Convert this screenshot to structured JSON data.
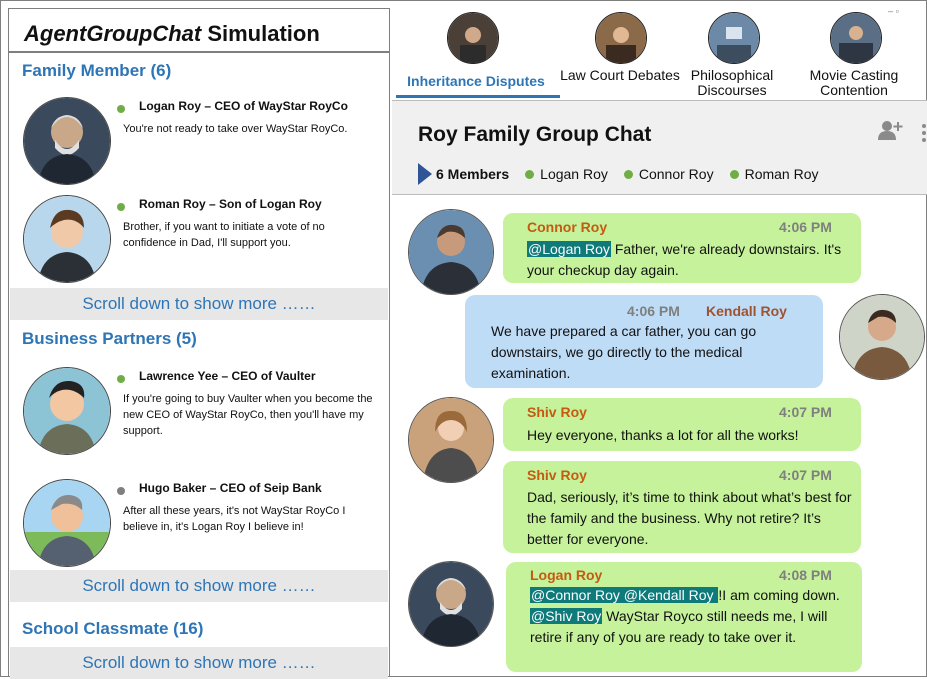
{
  "app": {
    "title_italic": "AgentGroupChat",
    "title_rest": " Simulation"
  },
  "sections": [
    {
      "header": "Family Member (6)",
      "more": "Scroll down to show more ……",
      "contacts": [
        {
          "name": "Logan Roy – CEO of WayStar RoyCo",
          "message": "You're not ready to take over WayStar RoyCo.",
          "status": "online"
        },
        {
          "name": "Roman Roy – Son of Logan Roy",
          "message": "Brother, if you want to initiate a vote of no confidence in Dad, I'll support you.",
          "status": "online"
        }
      ]
    },
    {
      "header": "Business Partners (5)",
      "more": "Scroll down to show more ……",
      "contacts": [
        {
          "name": "Lawrence Yee – CEO of Vaulter",
          "message": "If you're going to buy Vaulter when you become the new CEO of WayStar RoyCo, then you'll have my support.",
          "status": "online"
        },
        {
          "name": "Hugo Baker – CEO of Seip Bank",
          "message": "After all these years, it's not WayStar RoyCo I believe in, it's Logan Roy I believe in!",
          "status": "offline"
        }
      ]
    },
    {
      "header": "School Classmate (16)",
      "more": "Scroll down to show more ……",
      "contacts": []
    }
  ],
  "tabs": [
    {
      "label": "Inheritance Disputes",
      "active": true
    },
    {
      "label": "Law Court Debates",
      "active": false
    },
    {
      "label": "Philosophical Discourses",
      "active": false
    },
    {
      "label": "Movie Casting Contention",
      "active": false
    }
  ],
  "window_controls": "–  ▫",
  "chat": {
    "title": "Roy Family Group Chat",
    "member_count": "6 Members",
    "members": [
      "Logan Roy",
      "Connor Roy",
      "Roman Roy"
    ],
    "messages": [
      {
        "sender": "Connor Roy",
        "time": "4:06 PM",
        "side": "left",
        "mention": "@Logan Roy",
        "text": " Father, we're already downstairs. It's your checkup day again."
      },
      {
        "sender": "Kendall Roy",
        "time": "4:06 PM",
        "side": "right",
        "text": "We have prepared a car father, you can go downstairs, we go directly to the medical examination."
      },
      {
        "sender": "Shiv Roy",
        "time": "4:07 PM",
        "side": "left",
        "text": "Hey everyone, thanks a lot for all the works!"
      },
      {
        "sender": "Shiv Roy",
        "time": "4:07 PM",
        "side": "left",
        "text": "Dad, seriously, it’s time to think about what’s best for the family and the business. Why not retire? It’s better for everyone."
      },
      {
        "sender": "Logan Roy",
        "time": "4:08 PM",
        "side": "left",
        "mention1": "@Connor Roy @Kendall Roy ",
        "text1": "!I am coming down. ",
        "mention2": "@Shiv Roy",
        "text2": " WayStar Royco still needs me, I will retire if any of you are ready to take over it."
      }
    ]
  },
  "colors": {
    "accent": "#2e75b6",
    "online": "#70ad47",
    "offline": "#7f7f7f",
    "sender": "#c55a11",
    "mention_bg": "#0e7a7a",
    "bubble_green": "#c5f29a",
    "bubble_blue": "#bfdcf7"
  }
}
